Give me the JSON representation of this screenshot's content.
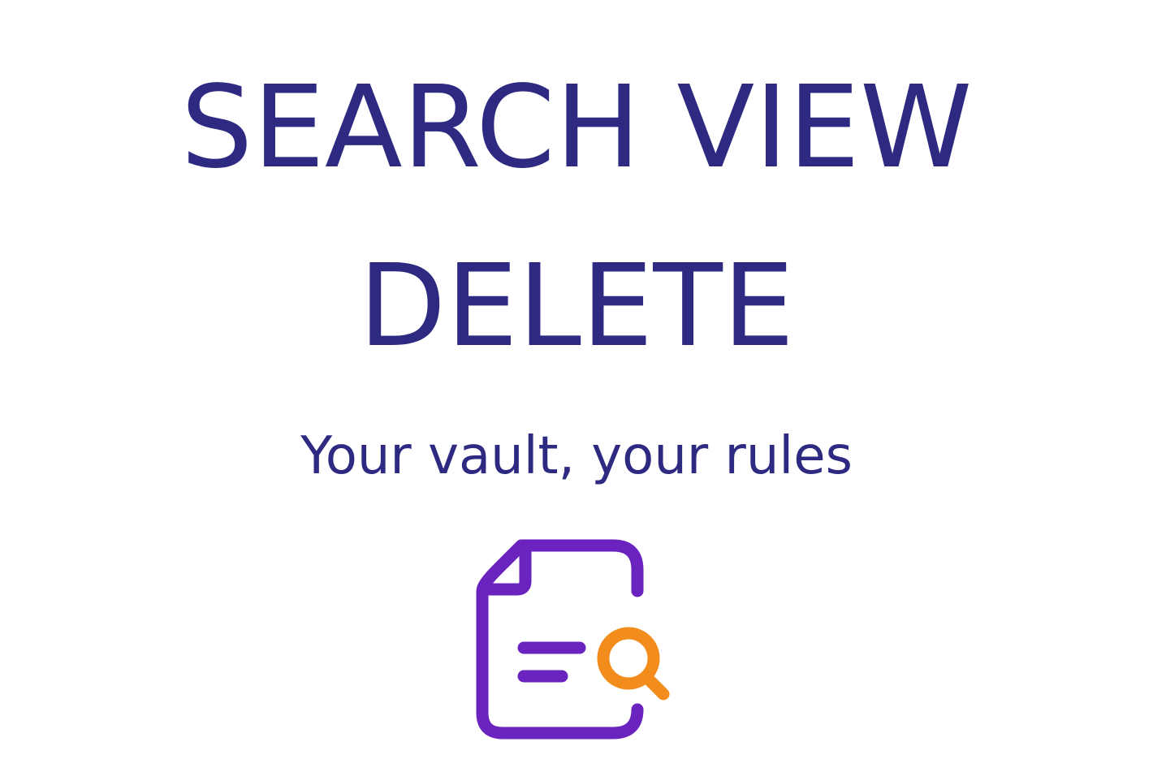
{
  "hero": {
    "line1": "SEARCH VIEW",
    "line2": "DELETE",
    "tagline": "Your vault, your rules"
  },
  "icon": {
    "name": "document-search-icon"
  },
  "colors": {
    "text": "#2e2a82",
    "document": "#6a23bf",
    "magnifier": "#f28c1c",
    "background": "#ffffff"
  }
}
